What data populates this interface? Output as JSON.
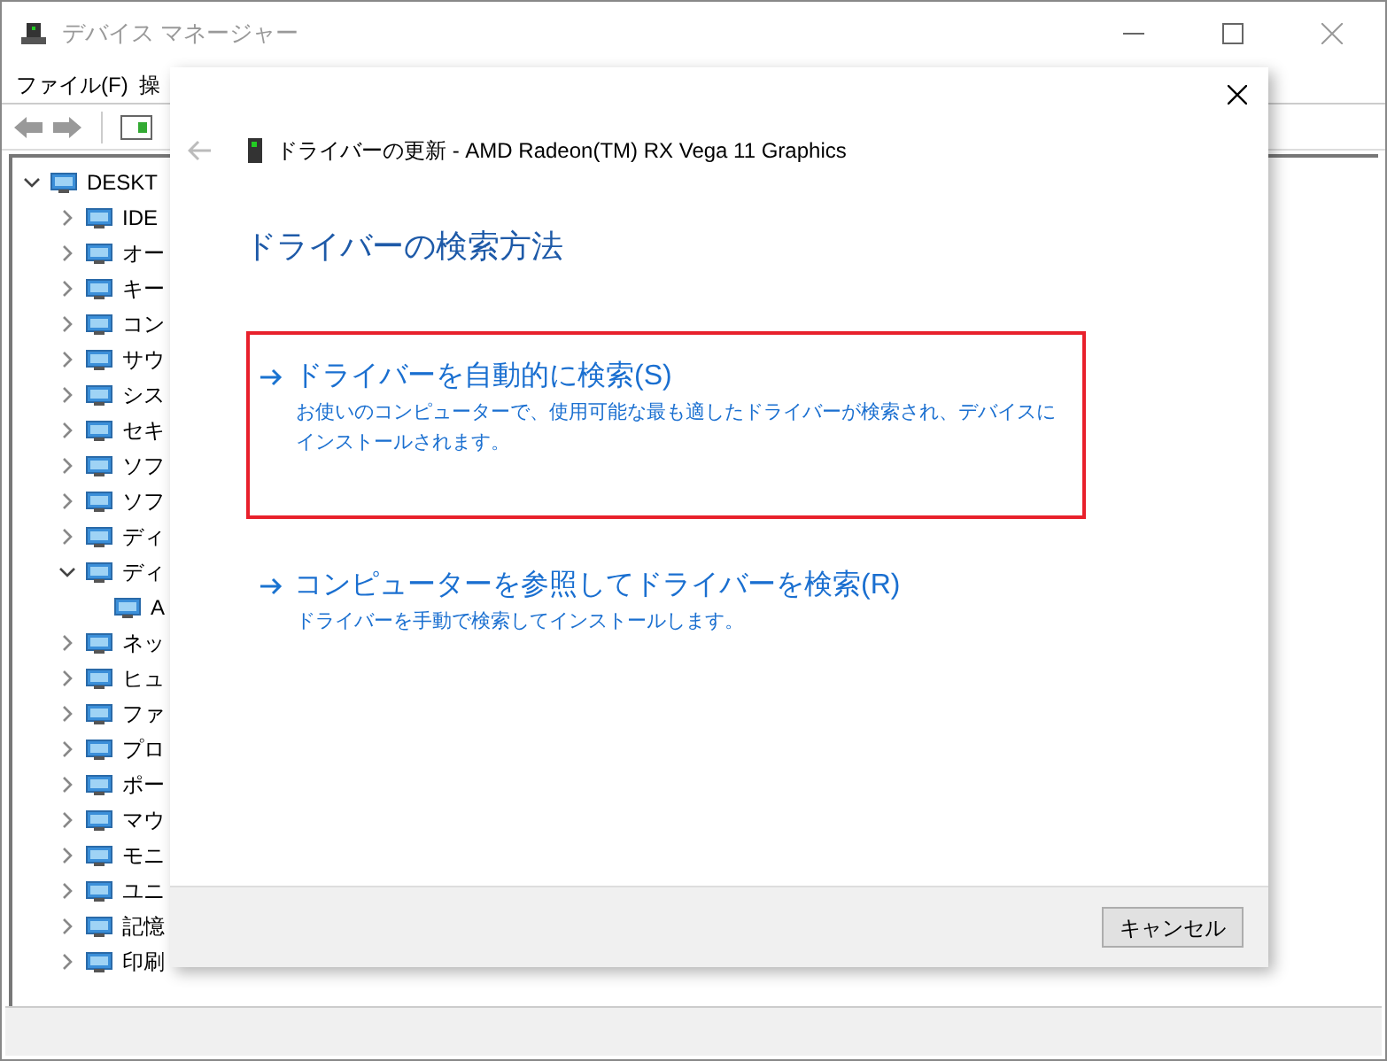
{
  "window": {
    "title": "デバイス マネージャー"
  },
  "menu": [
    "ファイル(F)",
    "操"
  ],
  "tree": {
    "root": {
      "label": "DESKT",
      "expanded": true
    },
    "items": [
      {
        "label": "IDE",
        "expanded": false
      },
      {
        "label": "オー",
        "expanded": false
      },
      {
        "label": "キー",
        "expanded": false
      },
      {
        "label": "コン",
        "expanded": false
      },
      {
        "label": "サウ",
        "expanded": false
      },
      {
        "label": "シス",
        "expanded": false
      },
      {
        "label": "セキ",
        "expanded": false
      },
      {
        "label": "ソフ",
        "expanded": false
      },
      {
        "label": "ソフ",
        "expanded": false
      },
      {
        "label": "ディ",
        "expanded": false
      },
      {
        "label": "ディ",
        "expanded": true,
        "children": [
          {
            "label": "A"
          }
        ]
      },
      {
        "label": "ネッ",
        "expanded": false
      },
      {
        "label": "ヒュ",
        "expanded": false
      },
      {
        "label": "ファ",
        "expanded": false
      },
      {
        "label": "プロ",
        "expanded": false
      },
      {
        "label": "ポー",
        "expanded": false
      },
      {
        "label": "マウ",
        "expanded": false
      },
      {
        "label": "モニ",
        "expanded": false
      },
      {
        "label": "ユニ",
        "expanded": false
      },
      {
        "label": "記憶",
        "expanded": false
      },
      {
        "label": "印刷",
        "expanded": false
      }
    ]
  },
  "dialog": {
    "title": "ドライバーの更新 - AMD Radeon(TM) RX Vega 11 Graphics",
    "heading": "ドライバーの検索方法",
    "options": [
      {
        "title": "ドライバーを自動的に検索(S)",
        "description": "お使いのコンピューターで、使用可能な最も適したドライバーが検索され、デバイスにインストールされます。",
        "selected": true
      },
      {
        "title": "コンピューターを参照してドライバーを検索(R)",
        "description": "ドライバーを手動で検索してインストールします。",
        "selected": false
      }
    ],
    "cancel_button": "キャンセル"
  }
}
